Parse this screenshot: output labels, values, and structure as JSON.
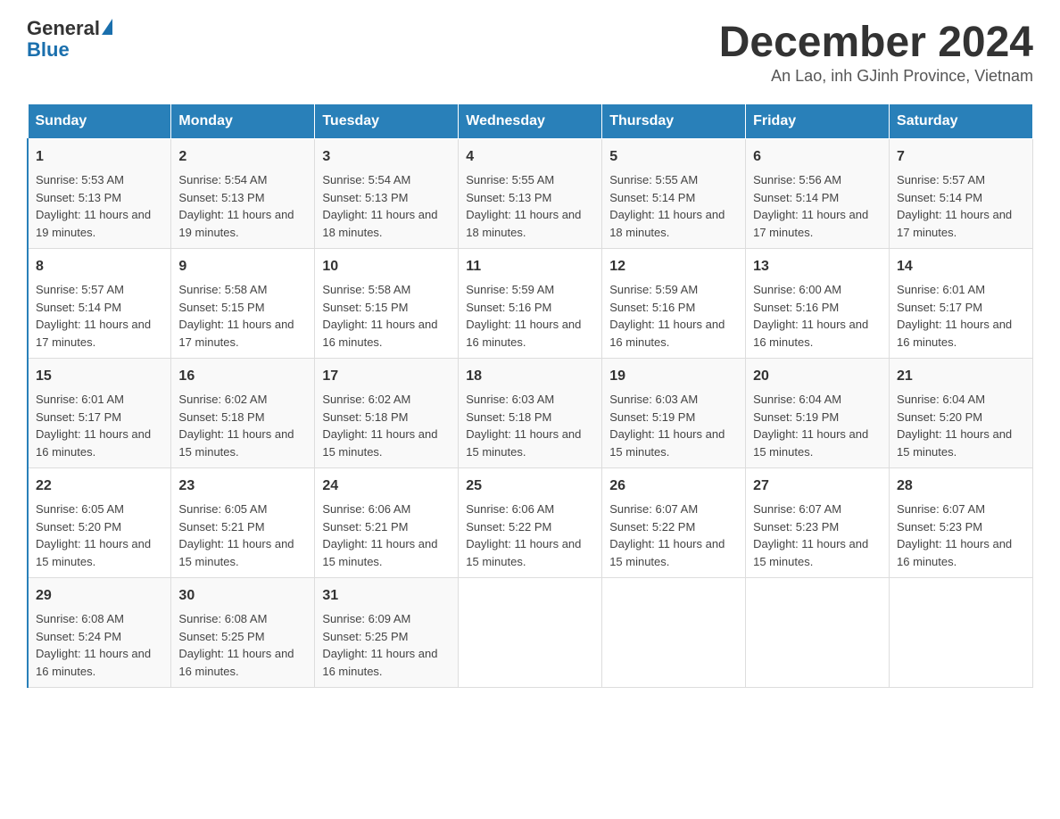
{
  "header": {
    "logo": {
      "general": "General",
      "blue": "Blue"
    },
    "title": "December 2024",
    "location": "An Lao, inh GJinh Province, Vietnam"
  },
  "calendar": {
    "days_of_week": [
      "Sunday",
      "Monday",
      "Tuesday",
      "Wednesday",
      "Thursday",
      "Friday",
      "Saturday"
    ],
    "weeks": [
      [
        {
          "day": "1",
          "sunrise": "5:53 AM",
          "sunset": "5:13 PM",
          "daylight": "11 hours and 19 minutes."
        },
        {
          "day": "2",
          "sunrise": "5:54 AM",
          "sunset": "5:13 PM",
          "daylight": "11 hours and 19 minutes."
        },
        {
          "day": "3",
          "sunrise": "5:54 AM",
          "sunset": "5:13 PM",
          "daylight": "11 hours and 18 minutes."
        },
        {
          "day": "4",
          "sunrise": "5:55 AM",
          "sunset": "5:13 PM",
          "daylight": "11 hours and 18 minutes."
        },
        {
          "day": "5",
          "sunrise": "5:55 AM",
          "sunset": "5:14 PM",
          "daylight": "11 hours and 18 minutes."
        },
        {
          "day": "6",
          "sunrise": "5:56 AM",
          "sunset": "5:14 PM",
          "daylight": "11 hours and 17 minutes."
        },
        {
          "day": "7",
          "sunrise": "5:57 AM",
          "sunset": "5:14 PM",
          "daylight": "11 hours and 17 minutes."
        }
      ],
      [
        {
          "day": "8",
          "sunrise": "5:57 AM",
          "sunset": "5:14 PM",
          "daylight": "11 hours and 17 minutes."
        },
        {
          "day": "9",
          "sunrise": "5:58 AM",
          "sunset": "5:15 PM",
          "daylight": "11 hours and 17 minutes."
        },
        {
          "day": "10",
          "sunrise": "5:58 AM",
          "sunset": "5:15 PM",
          "daylight": "11 hours and 16 minutes."
        },
        {
          "day": "11",
          "sunrise": "5:59 AM",
          "sunset": "5:16 PM",
          "daylight": "11 hours and 16 minutes."
        },
        {
          "day": "12",
          "sunrise": "5:59 AM",
          "sunset": "5:16 PM",
          "daylight": "11 hours and 16 minutes."
        },
        {
          "day": "13",
          "sunrise": "6:00 AM",
          "sunset": "5:16 PM",
          "daylight": "11 hours and 16 minutes."
        },
        {
          "day": "14",
          "sunrise": "6:01 AM",
          "sunset": "5:17 PM",
          "daylight": "11 hours and 16 minutes."
        }
      ],
      [
        {
          "day": "15",
          "sunrise": "6:01 AM",
          "sunset": "5:17 PM",
          "daylight": "11 hours and 16 minutes."
        },
        {
          "day": "16",
          "sunrise": "6:02 AM",
          "sunset": "5:18 PM",
          "daylight": "11 hours and 15 minutes."
        },
        {
          "day": "17",
          "sunrise": "6:02 AM",
          "sunset": "5:18 PM",
          "daylight": "11 hours and 15 minutes."
        },
        {
          "day": "18",
          "sunrise": "6:03 AM",
          "sunset": "5:18 PM",
          "daylight": "11 hours and 15 minutes."
        },
        {
          "day": "19",
          "sunrise": "6:03 AM",
          "sunset": "5:19 PM",
          "daylight": "11 hours and 15 minutes."
        },
        {
          "day": "20",
          "sunrise": "6:04 AM",
          "sunset": "5:19 PM",
          "daylight": "11 hours and 15 minutes."
        },
        {
          "day": "21",
          "sunrise": "6:04 AM",
          "sunset": "5:20 PM",
          "daylight": "11 hours and 15 minutes."
        }
      ],
      [
        {
          "day": "22",
          "sunrise": "6:05 AM",
          "sunset": "5:20 PM",
          "daylight": "11 hours and 15 minutes."
        },
        {
          "day": "23",
          "sunrise": "6:05 AM",
          "sunset": "5:21 PM",
          "daylight": "11 hours and 15 minutes."
        },
        {
          "day": "24",
          "sunrise": "6:06 AM",
          "sunset": "5:21 PM",
          "daylight": "11 hours and 15 minutes."
        },
        {
          "day": "25",
          "sunrise": "6:06 AM",
          "sunset": "5:22 PM",
          "daylight": "11 hours and 15 minutes."
        },
        {
          "day": "26",
          "sunrise": "6:07 AM",
          "sunset": "5:22 PM",
          "daylight": "11 hours and 15 minutes."
        },
        {
          "day": "27",
          "sunrise": "6:07 AM",
          "sunset": "5:23 PM",
          "daylight": "11 hours and 15 minutes."
        },
        {
          "day": "28",
          "sunrise": "6:07 AM",
          "sunset": "5:23 PM",
          "daylight": "11 hours and 16 minutes."
        }
      ],
      [
        {
          "day": "29",
          "sunrise": "6:08 AM",
          "sunset": "5:24 PM",
          "daylight": "11 hours and 16 minutes."
        },
        {
          "day": "30",
          "sunrise": "6:08 AM",
          "sunset": "5:25 PM",
          "daylight": "11 hours and 16 minutes."
        },
        {
          "day": "31",
          "sunrise": "6:09 AM",
          "sunset": "5:25 PM",
          "daylight": "11 hours and 16 minutes."
        },
        null,
        null,
        null,
        null
      ]
    ]
  }
}
